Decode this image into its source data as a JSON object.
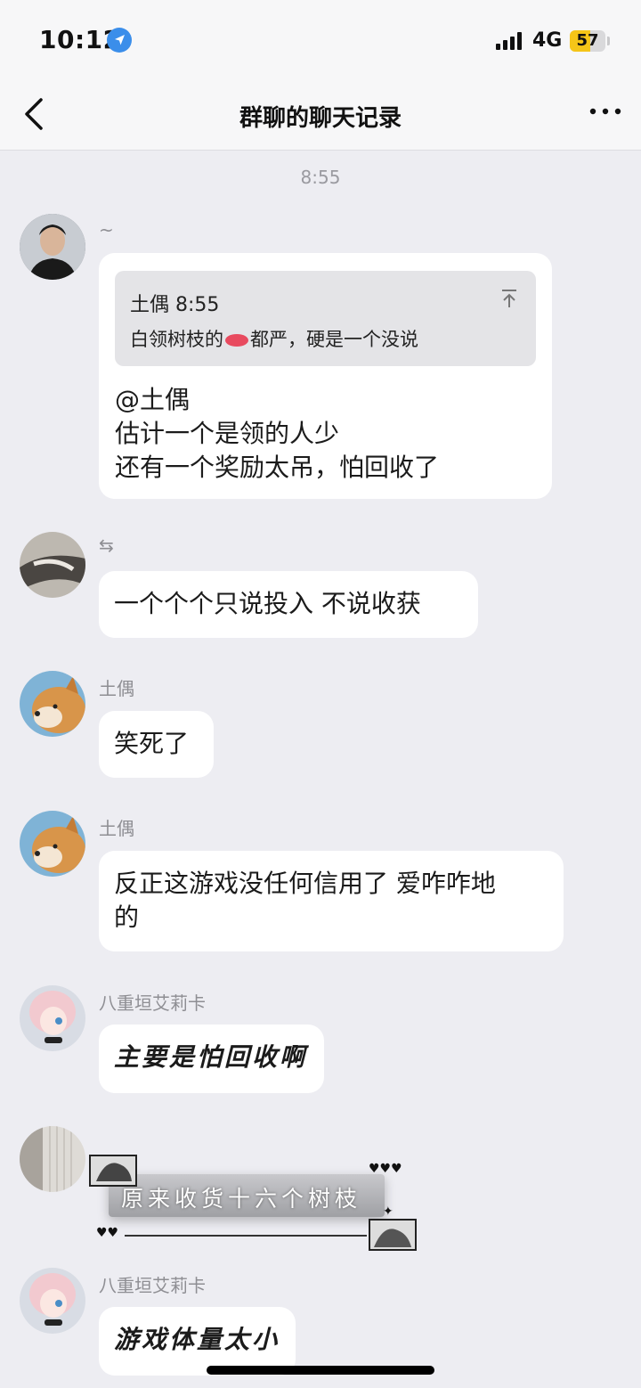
{
  "status": {
    "time": "10:12",
    "network": "4G",
    "battery": "57",
    "battery_level": 0.57
  },
  "nav": {
    "title": "群聊的聊天记录"
  },
  "timestamp": "8:55",
  "messages": [
    {
      "sender": "~",
      "quote": {
        "header": "土偶 8:55",
        "body_before": "白领树枝的",
        "body_after": "都严，硬是一个没说"
      },
      "text": "@土偶\n估计一个是领的人少\n还有一个奖励太吊，怕回收了"
    },
    {
      "sender": "⇆",
      "text": "一个个个只说投入 不说收获"
    },
    {
      "sender": "土偶",
      "text": "笑死了"
    },
    {
      "sender": "土偶",
      "text": "反正这游戏没任何信用了 爱咋咋地\n的"
    },
    {
      "sender": "八重垣艾莉卡",
      "text": "主要是怕回收啊"
    },
    {
      "sender": "",
      "text": "原来收货十六个树枝"
    },
    {
      "sender": "八重垣艾莉卡",
      "text": "游戏体量太小"
    }
  ]
}
